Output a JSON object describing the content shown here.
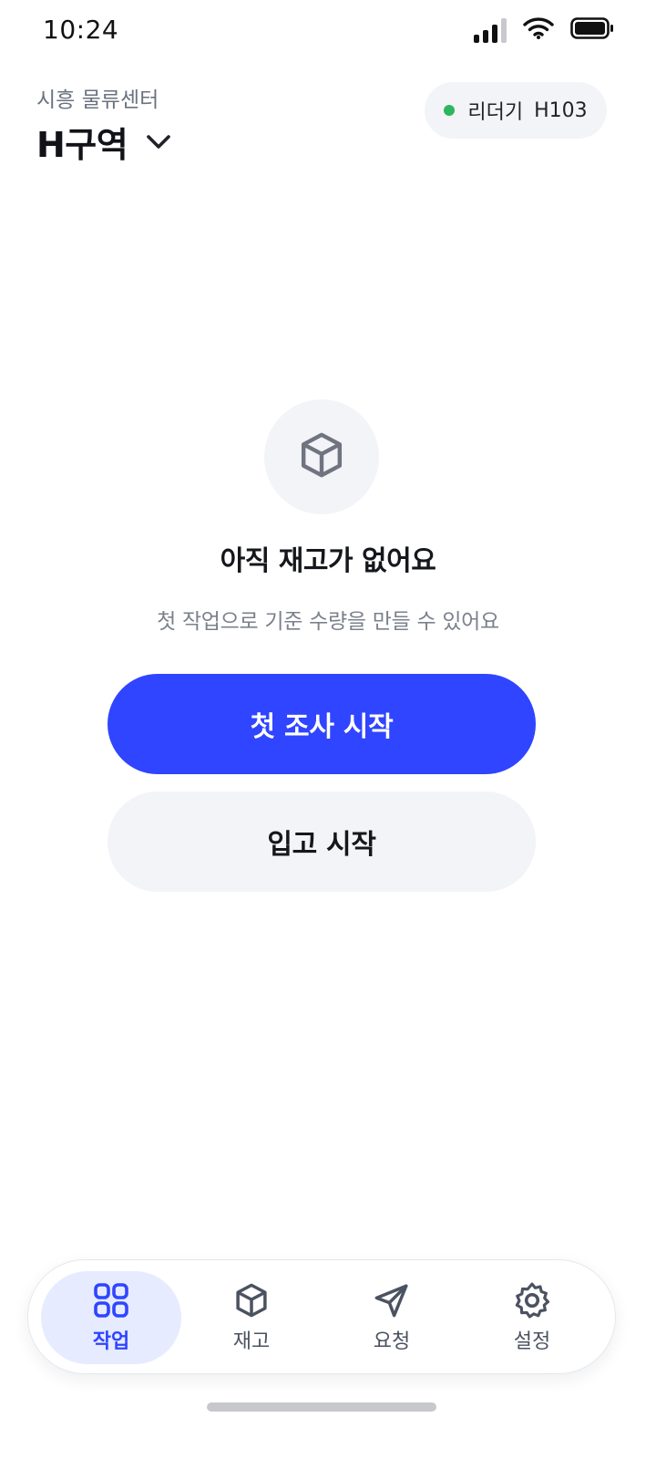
{
  "status_bar": {
    "time": "10:24"
  },
  "header": {
    "location": "시흥 물류센터",
    "zone": "H구역"
  },
  "reader": {
    "label": "리더기",
    "id": "H103",
    "status_color": "#2fb55f"
  },
  "empty_state": {
    "icon": "box-icon",
    "title": "아직 재고가 없어요",
    "description": "첫 작업으로 기준 수량을 만들 수 있어요"
  },
  "actions": {
    "primary_label": "첫 조사 시작",
    "secondary_label": "입고 시작"
  },
  "tabs": [
    {
      "label": "작업",
      "icon": "grid-icon",
      "active": true
    },
    {
      "label": "재고",
      "icon": "box-icon",
      "active": false
    },
    {
      "label": "요청",
      "icon": "send-icon",
      "active": false
    },
    {
      "label": "설정",
      "icon": "gear-icon",
      "active": false
    }
  ],
  "colors": {
    "accent": "#2f45ff",
    "accent_soft": "#e6ebff",
    "surface": "#f2f4f8"
  }
}
